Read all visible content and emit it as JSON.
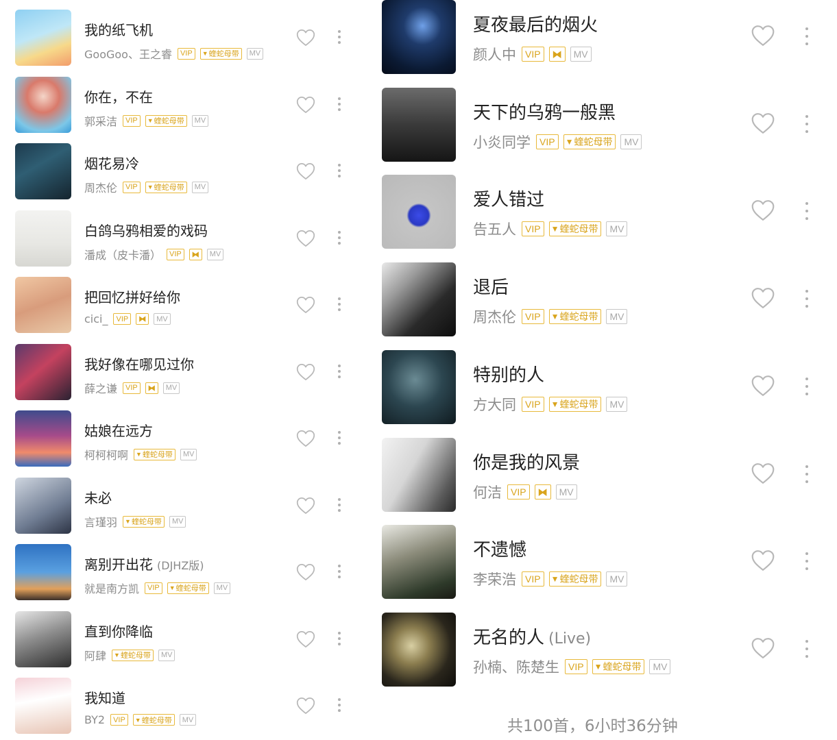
{
  "badges": {
    "vip": "VIP",
    "snake": "蝰蛇母带",
    "mv": "MV",
    "dolby": "⧓"
  },
  "left_songs": [
    {
      "title": "我的纸飞机",
      "subtitle": "",
      "artist": "GooGoo、王之睿",
      "badges": [
        "vip",
        "snake",
        "mv"
      ]
    },
    {
      "title": "你在，不在",
      "subtitle": "",
      "artist": "郭采洁",
      "badges": [
        "vip",
        "snake",
        "mv"
      ]
    },
    {
      "title": "烟花易冷",
      "subtitle": "",
      "artist": "周杰伦",
      "badges": [
        "vip",
        "snake",
        "mv"
      ]
    },
    {
      "title": "白鸽乌鸦相爱的戏码",
      "subtitle": "",
      "artist": "潘成（皮卡潘）",
      "badges": [
        "vip",
        "dolby",
        "mv"
      ]
    },
    {
      "title": "把回忆拼好给你",
      "subtitle": "",
      "artist": "cici_",
      "badges": [
        "vip",
        "dolby",
        "mv"
      ]
    },
    {
      "title": "我好像在哪见过你",
      "subtitle": "",
      "artist": "薛之谦",
      "badges": [
        "vip",
        "dolby",
        "mv"
      ]
    },
    {
      "title": "姑娘在远方",
      "subtitle": "",
      "artist": "柯柯柯啊",
      "badges": [
        "snake",
        "mv"
      ]
    },
    {
      "title": "未必",
      "subtitle": "",
      "artist": "言瑾羽",
      "badges": [
        "snake",
        "mv"
      ]
    },
    {
      "title": "离别开出花",
      "subtitle": "(DJHZ版)",
      "artist": "就是南方凯",
      "badges": [
        "vip",
        "snake",
        "mv"
      ]
    },
    {
      "title": "直到你降临",
      "subtitle": "",
      "artist": "阿肆",
      "badges": [
        "snake",
        "mv"
      ]
    },
    {
      "title": "我知道",
      "subtitle": "",
      "artist": "BY2",
      "badges": [
        "vip",
        "snake",
        "mv"
      ]
    }
  ],
  "right_songs": [
    {
      "title": "夏夜最后的烟火",
      "subtitle": "",
      "artist": "颜人中",
      "badges": [
        "vip",
        "dolby",
        "mv"
      ]
    },
    {
      "title": "天下的乌鸦一般黑",
      "subtitle": "",
      "artist": "小炎同学",
      "badges": [
        "vip",
        "snake",
        "mv"
      ]
    },
    {
      "title": "爱人错过",
      "subtitle": "",
      "artist": "告五人",
      "badges": [
        "vip",
        "snake",
        "mv"
      ]
    },
    {
      "title": "退后",
      "subtitle": "",
      "artist": "周杰伦",
      "badges": [
        "vip",
        "snake",
        "mv"
      ]
    },
    {
      "title": "特别的人",
      "subtitle": "",
      "artist": "方大同",
      "badges": [
        "vip",
        "snake",
        "mv"
      ]
    },
    {
      "title": "你是我的风景",
      "subtitle": "",
      "artist": "何洁",
      "badges": [
        "vip",
        "dolby",
        "mv"
      ]
    },
    {
      "title": "不遗憾",
      "subtitle": "",
      "artist": "李荣浩",
      "badges": [
        "vip",
        "snake",
        "mv"
      ]
    },
    {
      "title": "无名的人",
      "subtitle": "(Live)",
      "artist": "孙楠、陈楚生",
      "badges": [
        "vip",
        "snake",
        "mv"
      ]
    }
  ],
  "footer": "共100首，6小时36分钟",
  "colors": {
    "badge_gold": "#d9a41c",
    "badge_gray": "#a8a8a8",
    "title": "#222222",
    "artist": "#8c8c8c"
  }
}
